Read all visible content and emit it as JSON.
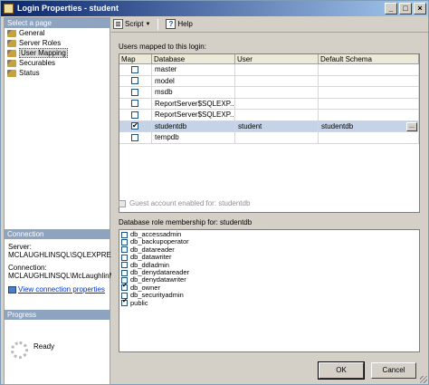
{
  "window": {
    "title": "Login Properties - student"
  },
  "left_pane": {
    "header": "Select a page",
    "pages": [
      {
        "label": "General",
        "selected": false
      },
      {
        "label": "Server Roles",
        "selected": false
      },
      {
        "label": "User Mapping",
        "selected": true
      },
      {
        "label": "Securables",
        "selected": false
      },
      {
        "label": "Status",
        "selected": false
      }
    ],
    "connection": {
      "header": "Connection",
      "server_label": "Server:",
      "server_value": "MCLAUGHLINSQL\\SQLEXPRES",
      "connection_label": "Connection:",
      "connection_value": "MCLAUGHLINSQL\\McLaughlinM",
      "link": "View connection properties"
    },
    "progress": {
      "header": "Progress",
      "status": "Ready"
    }
  },
  "toolbar": {
    "script": "Script",
    "help": "Help"
  },
  "mapping": {
    "label": "Users mapped to this login:",
    "columns": [
      "Map",
      "Database",
      "User",
      "Default Schema"
    ],
    "rows": [
      {
        "checked": false,
        "database": "master",
        "user": "",
        "schema": ""
      },
      {
        "checked": false,
        "database": "model",
        "user": "",
        "schema": ""
      },
      {
        "checked": false,
        "database": "msdb",
        "user": "",
        "schema": ""
      },
      {
        "checked": false,
        "database": "ReportServer$SQLEXP...",
        "user": "",
        "schema": ""
      },
      {
        "checked": false,
        "database": "ReportServer$SQLEXP...",
        "user": "",
        "schema": ""
      },
      {
        "checked": true,
        "database": "studentdb",
        "user": "student",
        "schema": "studentdb",
        "selected": true
      },
      {
        "checked": false,
        "database": "tempdb",
        "user": "",
        "schema": ""
      }
    ],
    "ellipsis": "..."
  },
  "guest": {
    "label": "Guest account enabled for: studentdb",
    "checked": false
  },
  "roles": {
    "label": "Database role membership for: studentdb",
    "items": [
      {
        "name": "db_accessadmin",
        "checked": false
      },
      {
        "name": "db_backupoperator",
        "checked": false
      },
      {
        "name": "db_datareader",
        "checked": false
      },
      {
        "name": "db_datawriter",
        "checked": false
      },
      {
        "name": "db_ddladmin",
        "checked": false
      },
      {
        "name": "db_denydatareader",
        "checked": false
      },
      {
        "name": "db_denydatawriter",
        "checked": false
      },
      {
        "name": "db_owner",
        "checked": true
      },
      {
        "name": "db_securityadmin",
        "checked": false
      },
      {
        "name": "public",
        "checked": true
      }
    ]
  },
  "buttons": {
    "ok": "OK",
    "cancel": "Cancel"
  },
  "colors": {
    "title_start": "#0a246a",
    "title_end": "#a6caf0",
    "selected_row": "#c6d3e6",
    "pane_header": "#8da3c0"
  }
}
